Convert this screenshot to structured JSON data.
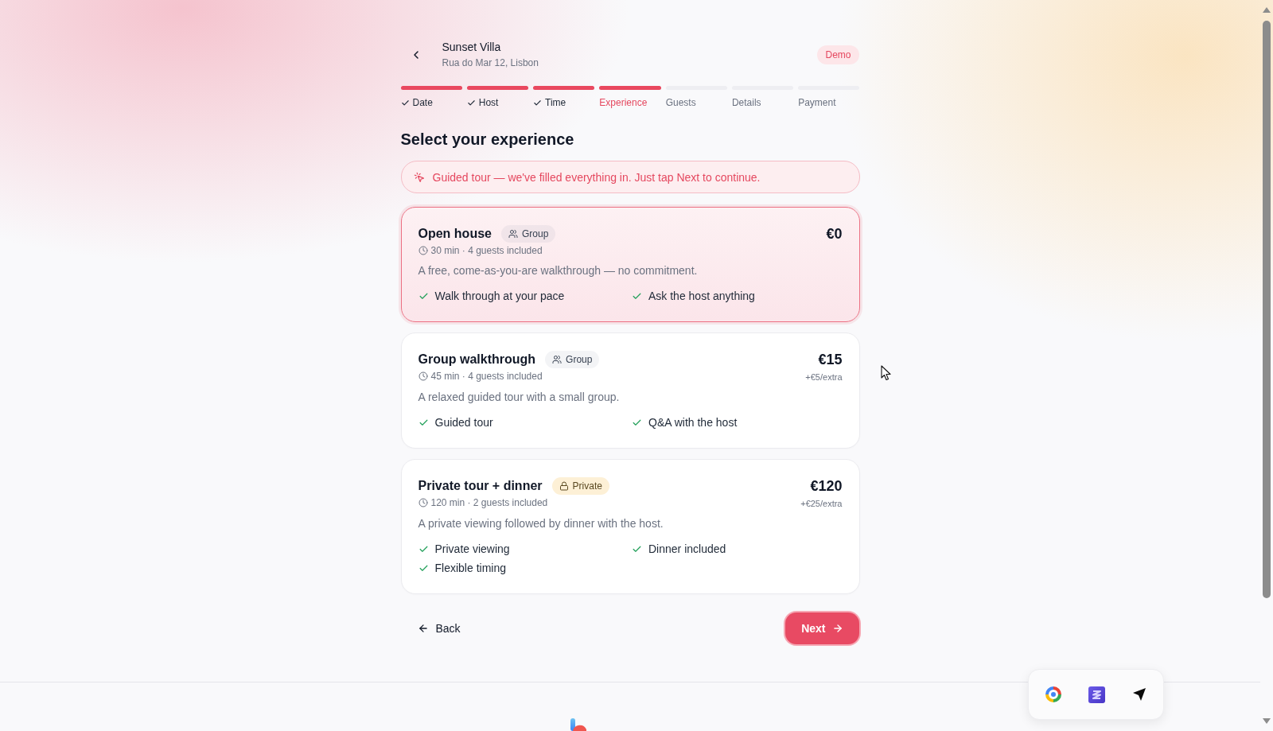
{
  "header": {
    "title": "Sunset Villa",
    "subtitle": "Rua do Mar 12, Lisbon",
    "badge": "Demo"
  },
  "steps": [
    {
      "label": "Date",
      "done": true,
      "selected": false
    },
    {
      "label": "Host",
      "done": true,
      "selected": false
    },
    {
      "label": "Time",
      "done": true,
      "selected": false
    },
    {
      "label": "Experience",
      "done": false,
      "selected": true
    },
    {
      "label": "Guests",
      "done": false,
      "selected": false
    },
    {
      "label": "Details",
      "done": false,
      "selected": false
    },
    {
      "label": "Payment",
      "done": false,
      "selected": false
    }
  ],
  "heading": "Select your experience",
  "notice": "Guided tour — we've filled everything in. Just tap Next to continue.",
  "experiences": [
    {
      "title": "Open house",
      "tag": {
        "kind": "group",
        "label": "Group"
      },
      "meta": "30 min · 4 guests included",
      "description": "A free, come-as-you-are walkthrough — no commitment.",
      "price": "€0",
      "features": [
        "Walk through at your pace",
        "Ask the host anything"
      ],
      "selected": true
    },
    {
      "title": "Group walkthrough",
      "tag": {
        "kind": "group",
        "label": "Group"
      },
      "meta": "45 min · 4 guests included",
      "description": "A relaxed guided tour with a small group.",
      "price": "€15",
      "price_note": "+€5/extra",
      "features": [
        "Guided tour",
        "Q&A with the host"
      ],
      "selected": false
    },
    {
      "title": "Private tour + dinner",
      "tag": {
        "kind": "private",
        "label": "Private"
      },
      "meta": "120 min · 2 guests included",
      "description": "A private viewing followed by dinner with the host.",
      "price": "€120",
      "price_note": "+€25/extra",
      "features": [
        "Private viewing",
        "Dinner included",
        "Flexible timing"
      ],
      "selected": false
    }
  ],
  "nav": {
    "back": "Back",
    "next": "Next"
  }
}
